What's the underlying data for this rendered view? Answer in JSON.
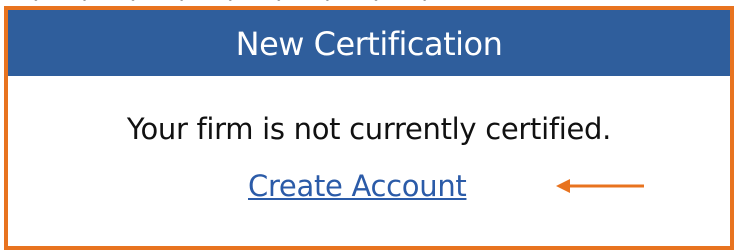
{
  "top_strip": {
    "partial_text": "• ⁀ • ⁀ • ⁀ • ⁀ • ⁀ • ⁀ • ⁀ • ⁀ •"
  },
  "card": {
    "title": "New Certification",
    "status_text": "Your firm is not currently certified.",
    "link_label": "Create Account"
  },
  "colors": {
    "highlight_border": "#e8731f",
    "header_background": "#2f5e9c",
    "link": "#2b5ba8",
    "annotation_arrow": "#e8731f"
  },
  "annotation": {
    "icon": "left-arrow-icon"
  }
}
